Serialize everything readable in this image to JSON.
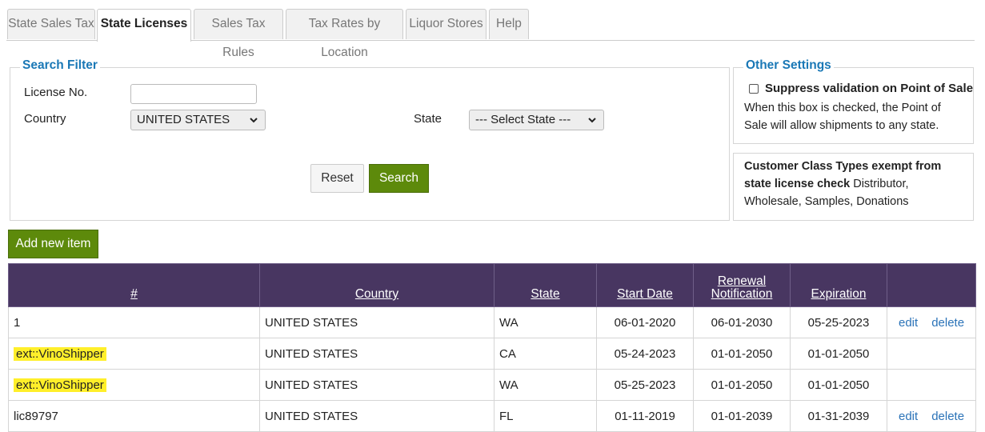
{
  "tabs": [
    {
      "label": "State Sales Tax"
    },
    {
      "label": "State Licenses"
    },
    {
      "label": "Sales Tax Rules"
    },
    {
      "label": "Tax Rates by Location"
    },
    {
      "label": "Liquor Stores"
    },
    {
      "label": "Help"
    }
  ],
  "search_filter": {
    "legend": "Search Filter",
    "license_label": "License No.",
    "license_value": "",
    "country_label": "Country",
    "country_value": "UNITED STATES",
    "state_label": "State",
    "state_value": "--- Select State ---",
    "reset_label": "Reset",
    "search_label": "Search"
  },
  "other_settings": {
    "legend": "Other Settings",
    "suppress_label": "Suppress validation on Point of Sale",
    "suppress_checked": false,
    "suppress_desc": "When this box is checked, the Point of Sale will allow shipments to any state.",
    "exempt_title": "Customer Class Types exempt from state license check",
    "exempt_list": "Distributor, Wholesale, Samples, Donations"
  },
  "add_button_label": "Add new item",
  "table": {
    "headers": [
      "#",
      "Country",
      "State",
      "Start Date",
      "Renewal Notification",
      "Expiration"
    ],
    "rows": [
      {
        "num": "1",
        "country": "UNITED STATES",
        "state": "WA",
        "start": "06-01-2020",
        "renewal": "06-01-2030",
        "expiration": "05-25-2023",
        "edit": "edit",
        "delete": "delete"
      },
      {
        "num": "ext::VinoShipper",
        "country": "UNITED STATES",
        "state": "CA",
        "start": "05-24-2023",
        "renewal": "01-01-2050",
        "expiration": "01-01-2050",
        "edit": "",
        "delete": ""
      },
      {
        "num": "ext::VinoShipper",
        "country": "UNITED STATES",
        "state": "WA",
        "start": "05-25-2023",
        "renewal": "01-01-2050",
        "expiration": "01-01-2050",
        "edit": "",
        "delete": ""
      },
      {
        "num": "lic89797",
        "country": "UNITED STATES",
        "state": "FL",
        "start": "01-11-2019",
        "renewal": "01-01-2039",
        "expiration": "01-31-2039",
        "edit": "edit",
        "delete": "delete"
      }
    ]
  }
}
